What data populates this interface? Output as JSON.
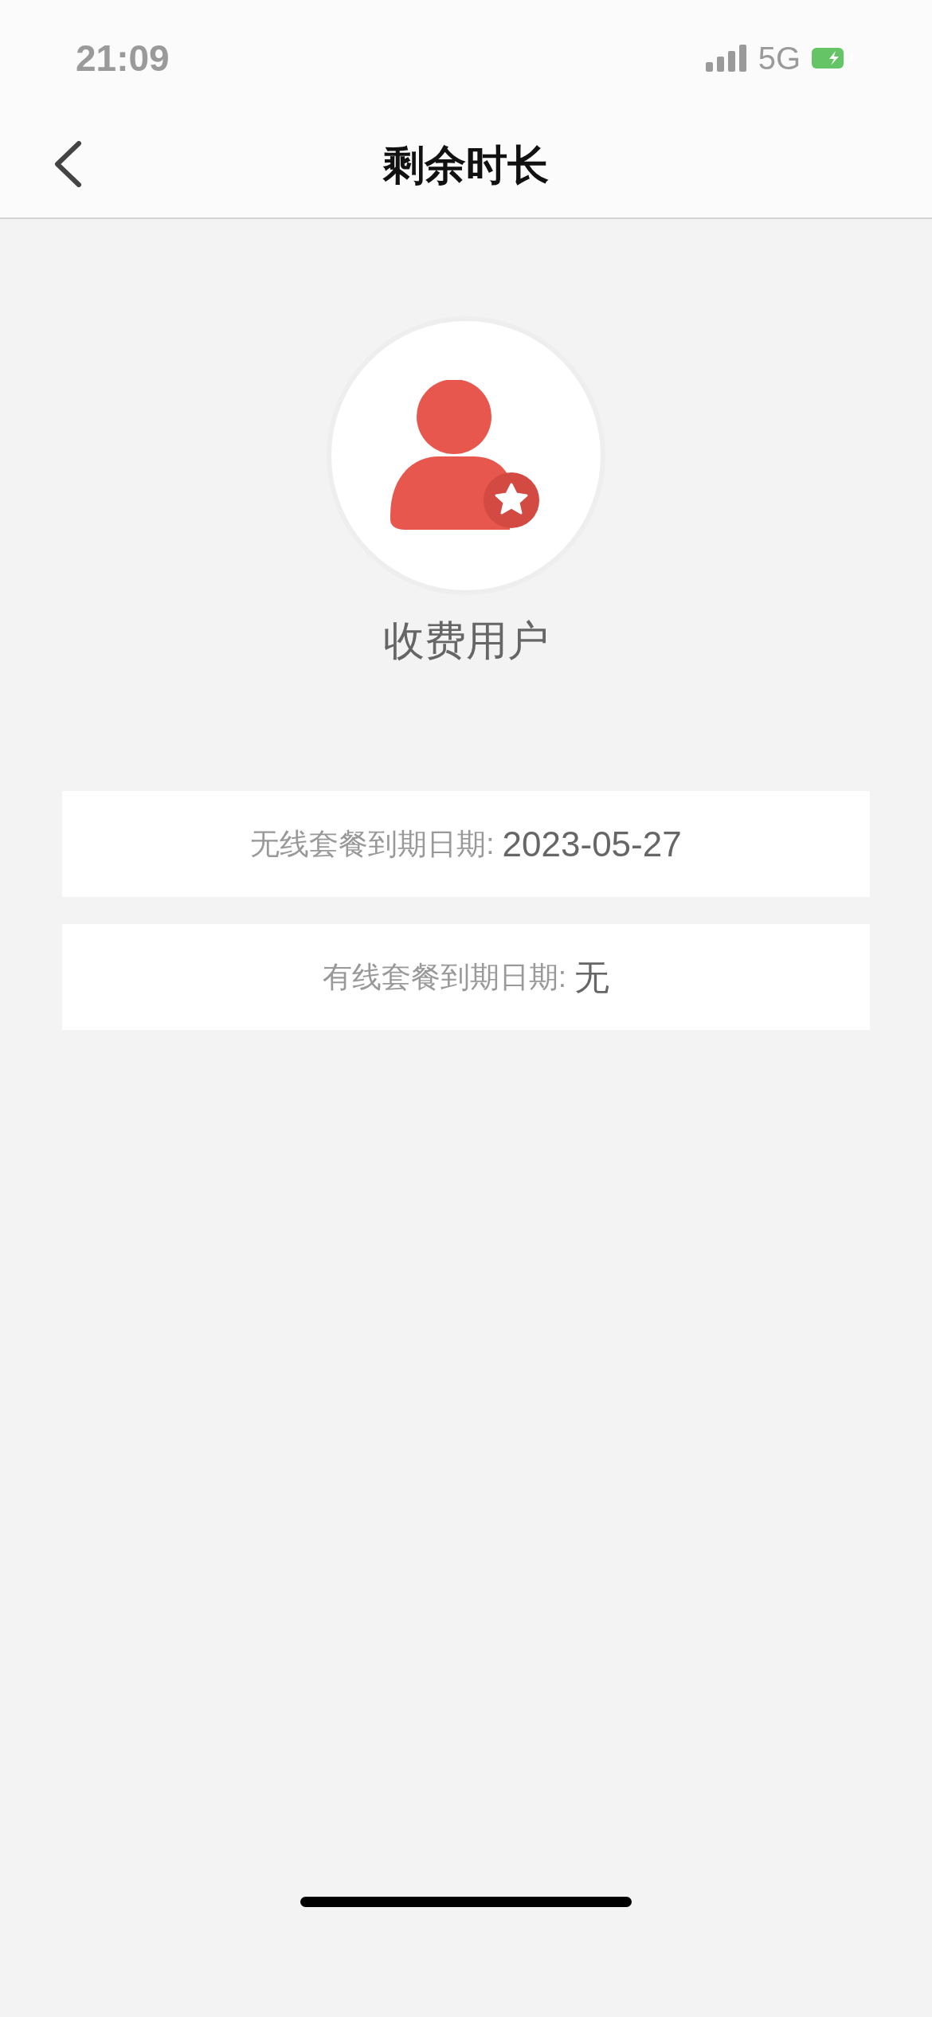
{
  "status_bar": {
    "time": "21:09",
    "network": "5G"
  },
  "nav": {
    "title": "剩余时长"
  },
  "user": {
    "type": "收费用户"
  },
  "plans": [
    {
      "label": "无线套餐到期日期:",
      "value": "2023-05-27"
    },
    {
      "label": "有线套餐到期日期:",
      "value": "无"
    }
  ]
}
